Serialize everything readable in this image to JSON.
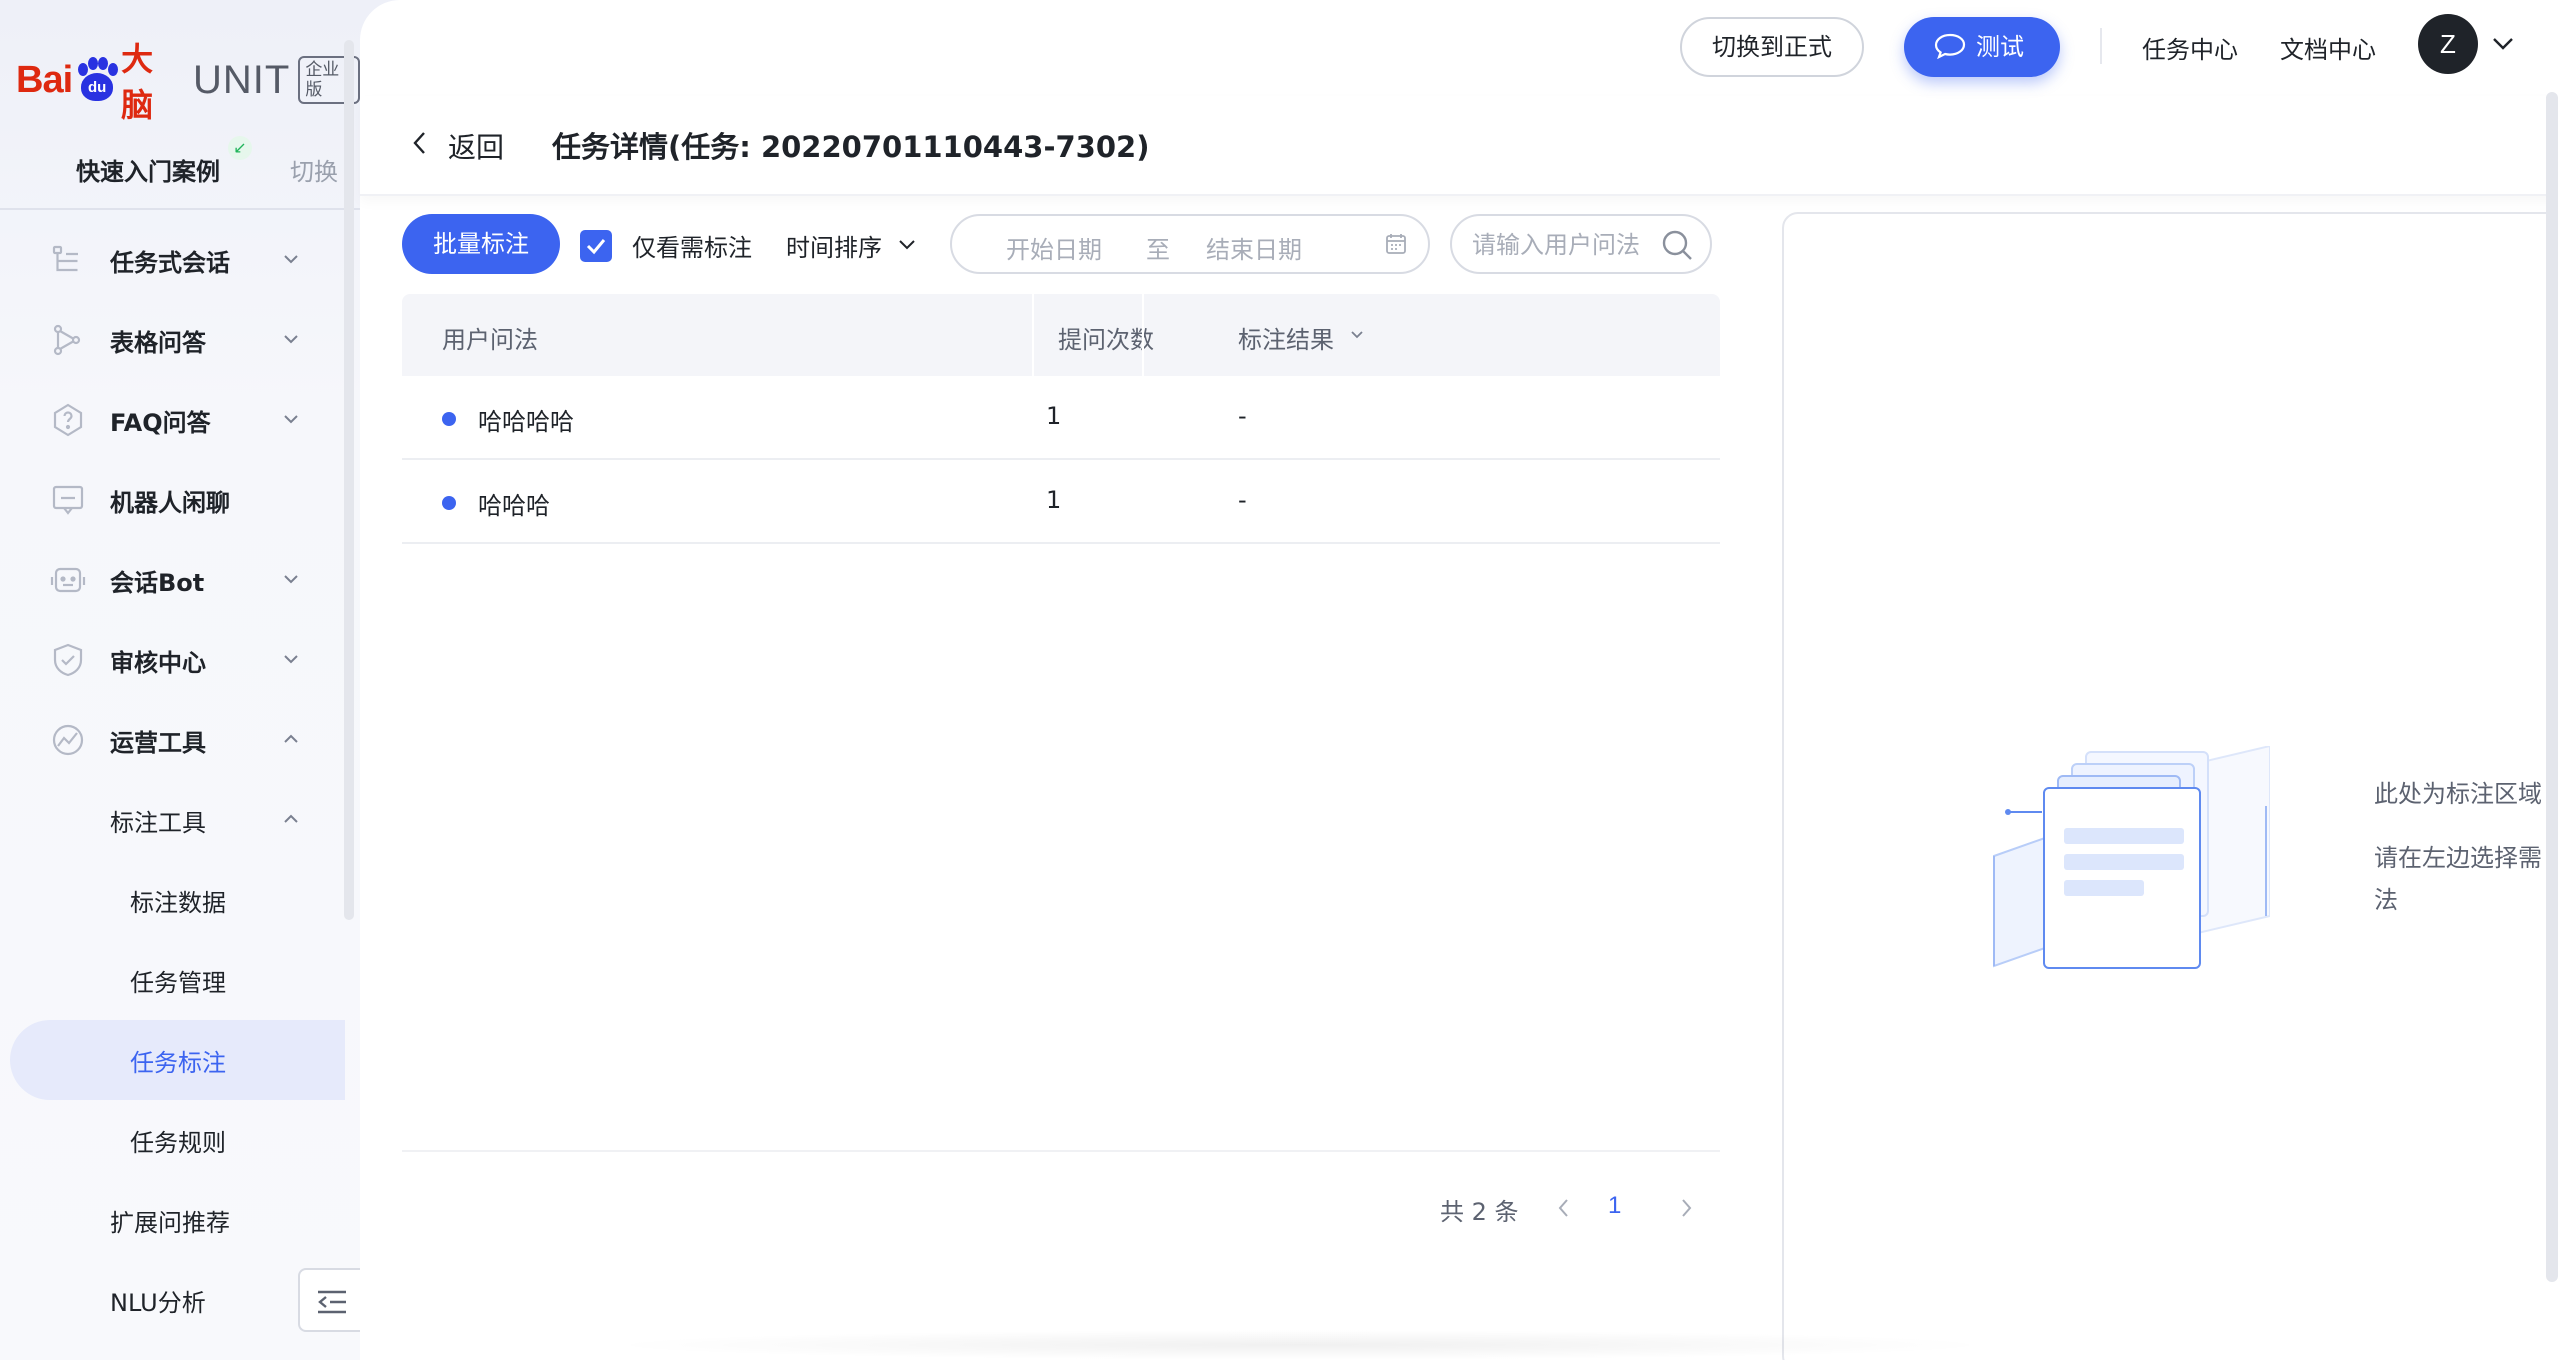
{
  "brand": {
    "bai": "Bai",
    "du": "du",
    "dana": "大脑",
    "unit": "UNIT",
    "badge": "企业版"
  },
  "project": {
    "name": "快速入门案例",
    "switch_label": "切换"
  },
  "sidebar": {
    "items": [
      {
        "label": "任务式会话",
        "icon": "task-dialog-icon",
        "chevron": "down"
      },
      {
        "label": "表格问答",
        "icon": "table-qa-icon",
        "chevron": "down"
      },
      {
        "label": "FAQ问答",
        "icon": "faq-icon",
        "chevron": "down"
      },
      {
        "label": "机器人闲聊",
        "icon": "chat-icon",
        "chevron": ""
      },
      {
        "label": "会话Bot",
        "icon": "bot-icon",
        "chevron": "down"
      },
      {
        "label": "审核中心",
        "icon": "shield-icon",
        "chevron": "down"
      },
      {
        "label": "运营工具",
        "icon": "ops-tools-icon",
        "chevron": "up"
      },
      {
        "label": "标注工具",
        "chevron": "up"
      },
      {
        "label": "标注数据"
      },
      {
        "label": "任务管理"
      },
      {
        "label": "任务标注",
        "active": true
      },
      {
        "label": "任务规则"
      },
      {
        "label": "扩展问推荐"
      },
      {
        "label": "NLU分析"
      }
    ]
  },
  "topbar": {
    "switch_formal": "切换到正式",
    "test": "测试",
    "task_center": "任务中心",
    "doc_center": "文档中心",
    "avatar_letter": "Z"
  },
  "header": {
    "back": "返回",
    "title": "任务详情(任务: 20220701110443-7302)"
  },
  "toolbar": {
    "batch_label": "批量标注",
    "only_need_label": "仅看需标注",
    "only_need_checked": true,
    "sort_label": "时间排序",
    "date_start_placeholder": "开始日期",
    "date_sep": "至",
    "date_end_placeholder": "结束日期",
    "search_placeholder": "请输入用户问法"
  },
  "table": {
    "columns": [
      "用户问法",
      "提问次数",
      "标注结果"
    ],
    "rows": [
      {
        "query": "哈哈哈哈",
        "count": "1",
        "result": "-"
      },
      {
        "query": "哈哈哈",
        "count": "1",
        "result": "-"
      }
    ]
  },
  "pager": {
    "total": "共 2 条",
    "current": "1"
  },
  "right_panel": {
    "hint_line1": "此处为标注区域",
    "hint_line2": "请在左边选择需",
    "hint_line3": "法"
  },
  "colors": {
    "accent": "#3c64f0",
    "brand_red": "#de2910",
    "brand_blue": "#2932e1"
  }
}
